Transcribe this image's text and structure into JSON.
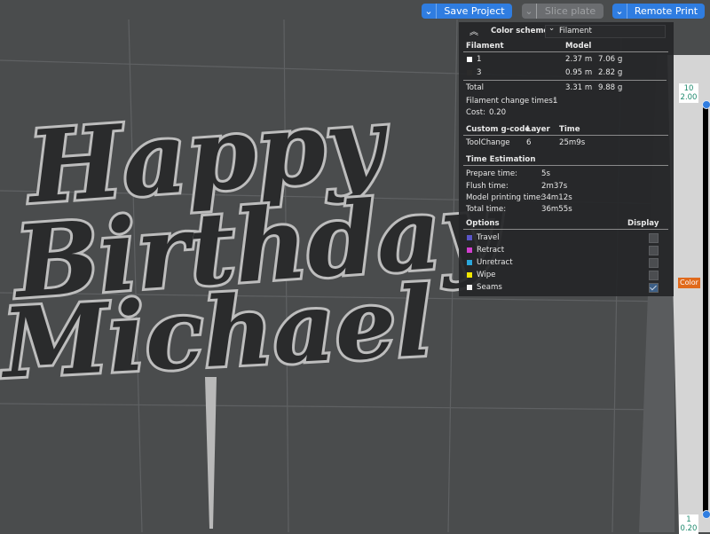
{
  "toolbar": {
    "save_project": "Save Project",
    "slice_plate": "Slice plate",
    "remote_print": "Remote Print"
  },
  "viewport": {
    "model_lines": [
      "Happy",
      "Birthday",
      "Michael"
    ]
  },
  "legend": {
    "color_scheme_label": "Color scheme",
    "color_scheme_value": "Filament",
    "filament_header": "Filament",
    "model_header": "Model",
    "filaments": [
      {
        "id": "1",
        "length": "2.37 m",
        "weight": "7.06 g",
        "color": "#ffffff"
      },
      {
        "id": "3",
        "length": "0.95 m",
        "weight": "2.82 g",
        "color": "#2b2b2b"
      }
    ],
    "total_label": "Total",
    "total_length": "3.31 m",
    "total_weight": "9.88 g",
    "change_times_label": "Filament change times:",
    "change_times_value": "1",
    "cost_label": "Cost:",
    "cost_value": "0.20",
    "custom_gcode_header": "Custom g-code",
    "layer_header": "Layer",
    "time_header": "Time",
    "custom_gcode_row": {
      "name": "ToolChange",
      "layer": "6",
      "time": "25m9s"
    },
    "time_estimation_header": "Time Estimation",
    "time_rows": [
      {
        "label": "Prepare time:",
        "value": "5s"
      },
      {
        "label": "Flush time:",
        "value": "2m37s"
      },
      {
        "label": "Model printing time:",
        "value": "34m12s"
      },
      {
        "label": "Total time:",
        "value": "36m55s"
      }
    ],
    "options_header": "Options",
    "display_header": "Display",
    "options": [
      {
        "label": "Travel",
        "color": "#5a55c8",
        "checked": false
      },
      {
        "label": "Retract",
        "color": "#d23fd0",
        "checked": false
      },
      {
        "label": "Unretract",
        "color": "#2aa7dc",
        "checked": false
      },
      {
        "label": "Wipe",
        "color": "#f0e600",
        "checked": false
      },
      {
        "label": "Seams",
        "color": "#f2f2f2",
        "checked": true
      }
    ]
  },
  "layer_slider": {
    "top_layer": "10",
    "top_height": "2.00",
    "bottom_layer": "1",
    "bottom_height": "0.20",
    "color_tag": "Color"
  },
  "colors": {
    "accent": "#2f7de1",
    "background": "#4a4c4d",
    "panel": "#252628",
    "color_tag": "#e06a1c"
  }
}
